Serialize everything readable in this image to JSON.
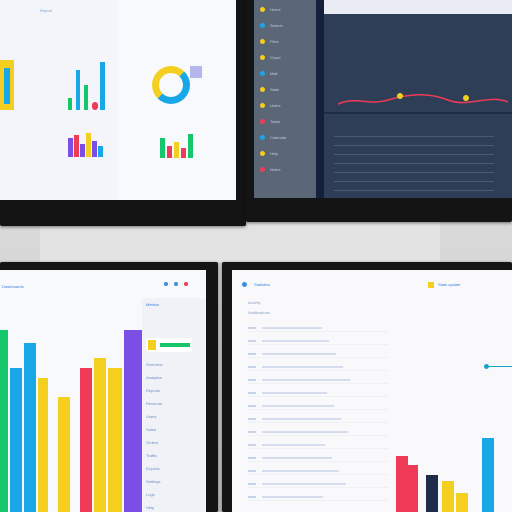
{
  "colors": {
    "red": "#ef3b57",
    "blue": "#1aa7e8",
    "yellow": "#f5cf1f",
    "green": "#16c66a",
    "purple": "#7b4ee6",
    "navy": "#1e2c4a",
    "dark_panel": "#2f3e57",
    "sidebar": "#5b6677"
  },
  "screen_bl": {
    "title": "Dashboards",
    "sidebar_heading": "Metrics",
    "sidebar_items": [
      "Overview",
      "Analytics",
      "Reports",
      "Revenue",
      "Users",
      "Sales",
      "Orders",
      "Traffic",
      "Exports",
      "Settings",
      "Logs",
      "Help",
      "Admin"
    ],
    "chart_data": {
      "type": "bar",
      "values": [
        95,
        75,
        88,
        70,
        60,
        75,
        80,
        75,
        95
      ]
    }
  },
  "screen_br": {
    "title": "Statistics",
    "badge": "Stats update",
    "section_title": "Activity",
    "subtitle": "Notifications",
    "table_rows": 14,
    "chart_data": {
      "type": "bar",
      "values": [
        45,
        38,
        30,
        25,
        15,
        60
      ]
    }
  },
  "screen_tl": {
    "title": "Report",
    "chart_data": {
      "type": "bar",
      "values": [
        60,
        70,
        40,
        75,
        50,
        35
      ]
    }
  },
  "screen_tr": {
    "nav_items": [
      "Home",
      "Search",
      "Files",
      "Cloud",
      "Mail",
      "Stats",
      "Users",
      "Tasks",
      "Calendar",
      "Help",
      "Notes"
    ]
  }
}
